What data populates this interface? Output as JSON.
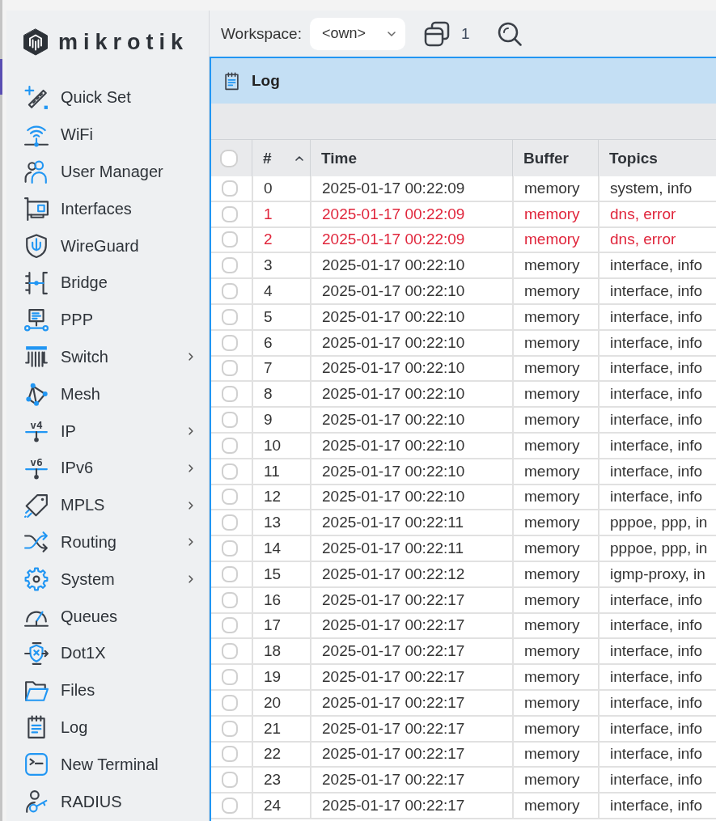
{
  "logo": {
    "text": "mikrotik"
  },
  "sidebar": {
    "items": [
      {
        "label": "Quick Set",
        "submenu": false,
        "selected": false
      },
      {
        "label": "WiFi",
        "submenu": false,
        "selected": false
      },
      {
        "label": "User Manager",
        "submenu": false,
        "selected": false
      },
      {
        "label": "Interfaces",
        "submenu": false,
        "selected": false
      },
      {
        "label": "WireGuard",
        "submenu": false,
        "selected": false
      },
      {
        "label": "Bridge",
        "submenu": false,
        "selected": false
      },
      {
        "label": "PPP",
        "submenu": false,
        "selected": false
      },
      {
        "label": "Switch",
        "submenu": true,
        "selected": false
      },
      {
        "label": "Mesh",
        "submenu": false,
        "selected": false
      },
      {
        "label": "IP",
        "submenu": true,
        "selected": false,
        "icon_text": "v4"
      },
      {
        "label": "IPv6",
        "submenu": true,
        "selected": false,
        "icon_text": "v6"
      },
      {
        "label": "MPLS",
        "submenu": true,
        "selected": false
      },
      {
        "label": "Routing",
        "submenu": true,
        "selected": false
      },
      {
        "label": "System",
        "submenu": true,
        "selected": false
      },
      {
        "label": "Queues",
        "submenu": false,
        "selected": false
      },
      {
        "label": "Dot1X",
        "submenu": false,
        "selected": false
      },
      {
        "label": "Files",
        "submenu": false,
        "selected": false
      },
      {
        "label": "Log",
        "submenu": false,
        "selected": false
      },
      {
        "label": "New Terminal",
        "submenu": false,
        "selected": false
      },
      {
        "label": "RADIUS",
        "submenu": false,
        "selected": false
      }
    ]
  },
  "toolbar": {
    "workspace_label": "Workspace:",
    "workspace": {
      "value": "<own>"
    },
    "windows_count": "1"
  },
  "window": {
    "title": "Log"
  },
  "table": {
    "select_all": {
      "checked": false
    },
    "columns": [
      {
        "label": "#",
        "sorted": true
      },
      {
        "label": "Time",
        "sorted": false
      },
      {
        "label": "Buffer",
        "sorted": false
      },
      {
        "label": "Topics",
        "sorted": false
      }
    ],
    "rows": [
      {
        "number": "0",
        "time": "2025-01-17 00:22:09",
        "buffer": "memory",
        "topics": "system, info",
        "error": false,
        "checked": false
      },
      {
        "number": "1",
        "time": "2025-01-17 00:22:09",
        "buffer": "memory",
        "topics": "dns, error",
        "error": true,
        "checked": false
      },
      {
        "number": "2",
        "time": "2025-01-17 00:22:09",
        "buffer": "memory",
        "topics": "dns, error",
        "error": true,
        "checked": false
      },
      {
        "number": "3",
        "time": "2025-01-17 00:22:10",
        "buffer": "memory",
        "topics": "interface, info",
        "error": false,
        "checked": false
      },
      {
        "number": "4",
        "time": "2025-01-17 00:22:10",
        "buffer": "memory",
        "topics": "interface, info",
        "error": false,
        "checked": false
      },
      {
        "number": "5",
        "time": "2025-01-17 00:22:10",
        "buffer": "memory",
        "topics": "interface, info",
        "error": false,
        "checked": false
      },
      {
        "number": "6",
        "time": "2025-01-17 00:22:10",
        "buffer": "memory",
        "topics": "interface, info",
        "error": false,
        "checked": false
      },
      {
        "number": "7",
        "time": "2025-01-17 00:22:10",
        "buffer": "memory",
        "topics": "interface, info",
        "error": false,
        "checked": false
      },
      {
        "number": "8",
        "time": "2025-01-17 00:22:10",
        "buffer": "memory",
        "topics": "interface, info",
        "error": false,
        "checked": false
      },
      {
        "number": "9",
        "time": "2025-01-17 00:22:10",
        "buffer": "memory",
        "topics": "interface, info",
        "error": false,
        "checked": false
      },
      {
        "number": "10",
        "time": "2025-01-17 00:22:10",
        "buffer": "memory",
        "topics": "interface, info",
        "error": false,
        "checked": false
      },
      {
        "number": "11",
        "time": "2025-01-17 00:22:10",
        "buffer": "memory",
        "topics": "interface, info",
        "error": false,
        "checked": false
      },
      {
        "number": "12",
        "time": "2025-01-17 00:22:10",
        "buffer": "memory",
        "topics": "interface, info",
        "error": false,
        "checked": false
      },
      {
        "number": "13",
        "time": "2025-01-17 00:22:11",
        "buffer": "memory",
        "topics": "pppoe, ppp, in",
        "error": false,
        "checked": false
      },
      {
        "number": "14",
        "time": "2025-01-17 00:22:11",
        "buffer": "memory",
        "topics": "pppoe, ppp, in",
        "error": false,
        "checked": false
      },
      {
        "number": "15",
        "time": "2025-01-17 00:22:12",
        "buffer": "memory",
        "topics": "igmp-proxy, in",
        "error": false,
        "checked": false
      },
      {
        "number": "16",
        "time": "2025-01-17 00:22:17",
        "buffer": "memory",
        "topics": "interface, info",
        "error": false,
        "checked": false
      },
      {
        "number": "17",
        "time": "2025-01-17 00:22:17",
        "buffer": "memory",
        "topics": "interface, info",
        "error": false,
        "checked": false
      },
      {
        "number": "18",
        "time": "2025-01-17 00:22:17",
        "buffer": "memory",
        "topics": "interface, info",
        "error": false,
        "checked": false
      },
      {
        "number": "19",
        "time": "2025-01-17 00:22:17",
        "buffer": "memory",
        "topics": "interface, info",
        "error": false,
        "checked": false
      },
      {
        "number": "20",
        "time": "2025-01-17 00:22:17",
        "buffer": "memory",
        "topics": "interface, info",
        "error": false,
        "checked": false
      },
      {
        "number": "21",
        "time": "2025-01-17 00:22:17",
        "buffer": "memory",
        "topics": "interface, info",
        "error": false,
        "checked": false
      },
      {
        "number": "22",
        "time": "2025-01-17 00:22:17",
        "buffer": "memory",
        "topics": "interface, info",
        "error": false,
        "checked": false
      },
      {
        "number": "23",
        "time": "2025-01-17 00:22:17",
        "buffer": "memory",
        "topics": "interface, info",
        "error": false,
        "checked": false
      },
      {
        "number": "24",
        "time": "2025-01-17 00:22:17",
        "buffer": "memory",
        "topics": "interface, info",
        "error": false,
        "checked": false
      }
    ]
  }
}
